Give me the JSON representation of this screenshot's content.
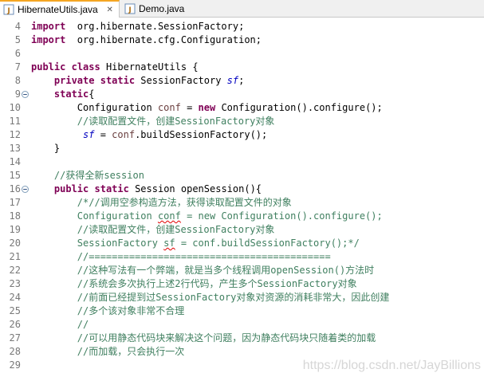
{
  "tabs": [
    {
      "label": "HibernateUtils.java",
      "close": "✕",
      "icon": "java-file-icon"
    },
    {
      "label": "Demo.java",
      "icon": "java-file-icon"
    }
  ],
  "lines": [
    {
      "n": "4",
      "t": [
        [
          "kw",
          "import"
        ],
        [
          "",
          "  org.hibernate.SessionFactory;"
        ]
      ]
    },
    {
      "n": "5",
      "t": [
        [
          "kw",
          "import"
        ],
        [
          "",
          "  org.hibernate.cfg.Configuration;"
        ]
      ]
    },
    {
      "n": "6",
      "t": []
    },
    {
      "n": "7",
      "t": [
        [
          "kw",
          "public"
        ],
        [
          "",
          " "
        ],
        [
          "kw",
          "class"
        ],
        [
          "",
          " HibernateUtils {"
        ]
      ]
    },
    {
      "n": "8",
      "t": [
        [
          "",
          "    "
        ],
        [
          "kw",
          "private"
        ],
        [
          "",
          " "
        ],
        [
          "kw",
          "static"
        ],
        [
          "",
          " SessionFactory "
        ],
        [
          "field",
          "sf"
        ],
        [
          "",
          ";"
        ]
      ]
    },
    {
      "n": "9",
      "fold": true,
      "t": [
        [
          "",
          "    "
        ],
        [
          "kw",
          "static"
        ],
        [
          "",
          "{"
        ]
      ]
    },
    {
      "n": "10",
      "t": [
        [
          "",
          "        Configuration "
        ],
        [
          "var",
          "conf"
        ],
        [
          "",
          " = "
        ],
        [
          "kw",
          "new"
        ],
        [
          "",
          " Configuration().configure();"
        ]
      ]
    },
    {
      "n": "11",
      "t": [
        [
          "",
          "        "
        ],
        [
          "cmt",
          "//读取配置文件，创建SessionFactory对象"
        ]
      ]
    },
    {
      "n": "12",
      "t": [
        [
          "",
          "         "
        ],
        [
          "field",
          "sf"
        ],
        [
          "",
          " = "
        ],
        [
          "var",
          "conf"
        ],
        [
          "",
          ".buildSessionFactory();"
        ]
      ]
    },
    {
      "n": "13",
      "t": [
        [
          "",
          "    }"
        ]
      ]
    },
    {
      "n": "14",
      "t": []
    },
    {
      "n": "15",
      "t": [
        [
          "",
          "    "
        ],
        [
          "cmt",
          "//获得全新session"
        ]
      ]
    },
    {
      "n": "16",
      "fold": true,
      "t": [
        [
          "",
          "    "
        ],
        [
          "kw",
          "public"
        ],
        [
          "",
          " "
        ],
        [
          "kw",
          "static"
        ],
        [
          "",
          " Session openSession(){"
        ]
      ]
    },
    {
      "n": "17",
      "t": [
        [
          "",
          "        "
        ],
        [
          "cmt",
          "/*//调用空参构造方法，获得读取配置文件的对象"
        ]
      ]
    },
    {
      "n": "18",
      "t": [
        [
          "",
          "        "
        ],
        [
          "cmt",
          "Configuration "
        ],
        [
          "cmt squig",
          "conf"
        ],
        [
          "cmt",
          " = new Configuration().configure();"
        ]
      ]
    },
    {
      "n": "19",
      "t": [
        [
          "",
          "        "
        ],
        [
          "cmt",
          "//读取配置文件，创建SessionFactory对象"
        ]
      ]
    },
    {
      "n": "20",
      "t": [
        [
          "",
          "        "
        ],
        [
          "cmt",
          "SessionFactory "
        ],
        [
          "cmt squig",
          "sf"
        ],
        [
          "cmt",
          " = conf.buildSessionFactory();*/"
        ]
      ]
    },
    {
      "n": "21",
      "t": [
        [
          "",
          "        "
        ],
        [
          "cmt",
          "//=========================================="
        ]
      ]
    },
    {
      "n": "22",
      "t": [
        [
          "",
          "        "
        ],
        [
          "cmt",
          "//这种写法有一个弊端，就是当多个线程调用openSession()方法时"
        ]
      ]
    },
    {
      "n": "23",
      "t": [
        [
          "",
          "        "
        ],
        [
          "cmt",
          "//系统会多次执行上述2行代码，产生多个SessionFactory对象"
        ]
      ]
    },
    {
      "n": "24",
      "t": [
        [
          "",
          "        "
        ],
        [
          "cmt",
          "//前面已经提到过SessionFactory对象对资源的消耗非常大，因此创建"
        ]
      ]
    },
    {
      "n": "25",
      "t": [
        [
          "",
          "        "
        ],
        [
          "cmt",
          "//多个该对象非常不合理"
        ]
      ]
    },
    {
      "n": "26",
      "t": [
        [
          "",
          "        "
        ],
        [
          "cmt",
          "//"
        ]
      ]
    },
    {
      "n": "27",
      "t": [
        [
          "",
          "        "
        ],
        [
          "cmt",
          "//可以用静态代码块来解决这个问题，因为静态代码块只随着类的加载"
        ]
      ]
    },
    {
      "n": "28",
      "t": [
        [
          "",
          "        "
        ],
        [
          "cmt",
          "//而加载，只会执行一次"
        ]
      ]
    },
    {
      "n": "29",
      "t": []
    }
  ],
  "watermark": "https://blog.csdn.net/JayBillions",
  "colors": {
    "keyword": "#7f0055",
    "field": "#0000c0",
    "variable": "#6a3e3e",
    "comment": "#3f7f5f",
    "line_number": "#787878",
    "active_tab_accent": "#f5a623"
  }
}
